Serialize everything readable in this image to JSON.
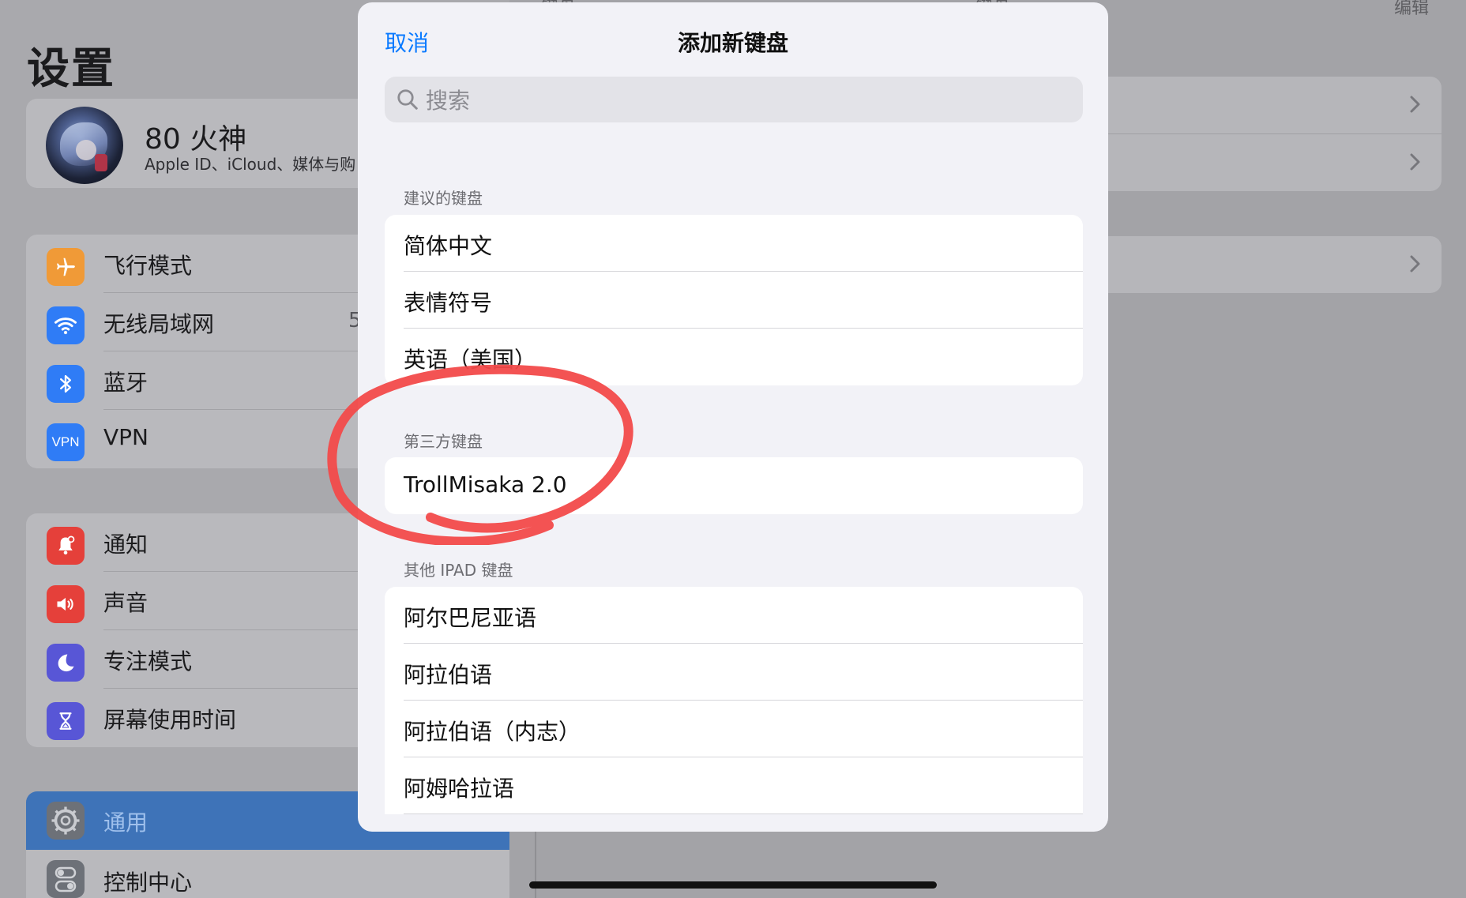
{
  "background": {
    "settings_title": "设置",
    "profile": {
      "name": "80 火神",
      "subtitle": "Apple ID、iCloud、媒体与购"
    },
    "group1": [
      {
        "label": "飞行模式",
        "icon": "airplane-icon",
        "color": "#f09a37"
      },
      {
        "label": "无线局域网",
        "icon": "wifi-icon",
        "color": "#2f7cf6",
        "trail": "5"
      },
      {
        "label": "蓝牙",
        "icon": "bluetooth-icon",
        "color": "#2f7cf6"
      },
      {
        "label": "VPN",
        "icon": "vpn-icon",
        "color": "#2f7cf6"
      }
    ],
    "group2": [
      {
        "label": "通知",
        "icon": "bell-icon",
        "color": "#e5403a"
      },
      {
        "label": "声音",
        "icon": "speaker-icon",
        "color": "#e5403a"
      },
      {
        "label": "专注模式",
        "icon": "moon-icon",
        "color": "#5856d6"
      },
      {
        "label": "屏幕使用时间",
        "icon": "hourglass-icon",
        "color": "#5856d6"
      }
    ],
    "general_label": "通用",
    "control_center_label": "控制中心",
    "right_header_left": "键盘",
    "right_header_center": "键盘",
    "right_header_right": "编辑"
  },
  "sheet": {
    "cancel_label": "取消",
    "title": "添加新键盘",
    "search_placeholder": "搜索",
    "suggested_header": "建议的键盘",
    "suggested": [
      "简体中文",
      "表情符号",
      "英语（美国）"
    ],
    "third_party_header": "第三方键盘",
    "third_party": [
      "TrollMisaka 2.0"
    ],
    "other_header": "其他 IPAD 键盘",
    "other": [
      "阿尔巴尼亚语",
      "阿拉伯语",
      "阿拉伯语（内志）",
      "阿姆哈拉语"
    ]
  },
  "colors": {
    "accent": "#0a7aff",
    "annotation": "#f24a4a"
  }
}
